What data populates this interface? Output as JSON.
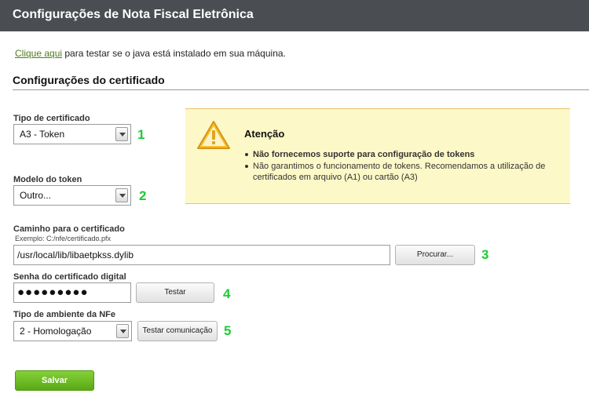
{
  "header": {
    "title": "Configurações de Nota Fiscal Eletrônica"
  },
  "java_check": {
    "link_text": "Clique aqui",
    "rest_text": " para testar se o java está instalado em sua máquina."
  },
  "section": {
    "title": "Configurações do certificado"
  },
  "cert_type": {
    "label": "Tipo de certificado",
    "value": "A3 - Token",
    "step": "1"
  },
  "token_model": {
    "label": "Modelo do token",
    "value": "Outro...",
    "step": "2"
  },
  "cert_path": {
    "label": "Caminho para o certificado",
    "hint": "Exemplo: C:/nfe/certificado.pfx",
    "value": "/usr/local/lib/libaetpkss.dylib",
    "button": "Procurar...",
    "step": "3"
  },
  "cert_password": {
    "label": "Senha do certificado digital",
    "value": "●●●●●●●●●",
    "button": "Testar",
    "step": "4"
  },
  "environment": {
    "label": "Tipo de ambiente da NFe",
    "value": "2 - Homologação",
    "button": "Testar comunicação",
    "step": "5"
  },
  "warning": {
    "title": "Atenção",
    "items": [
      "Não fornecemos suporte para configuração de tokens",
      "Não garantimos o funcionamento de tokens. Recomendamos a utilização de certificados em arquivo (A1) ou cartão (A3)"
    ],
    "icon": "warning-triangle-icon"
  },
  "actions": {
    "save_label": "Salvar"
  },
  "colors": {
    "header_bg": "#4a4e53",
    "step_number": "#1ccc33",
    "save_button": "#6cbb22",
    "warning_bg": "#fdf8c7",
    "link": "#4f7d1a"
  }
}
